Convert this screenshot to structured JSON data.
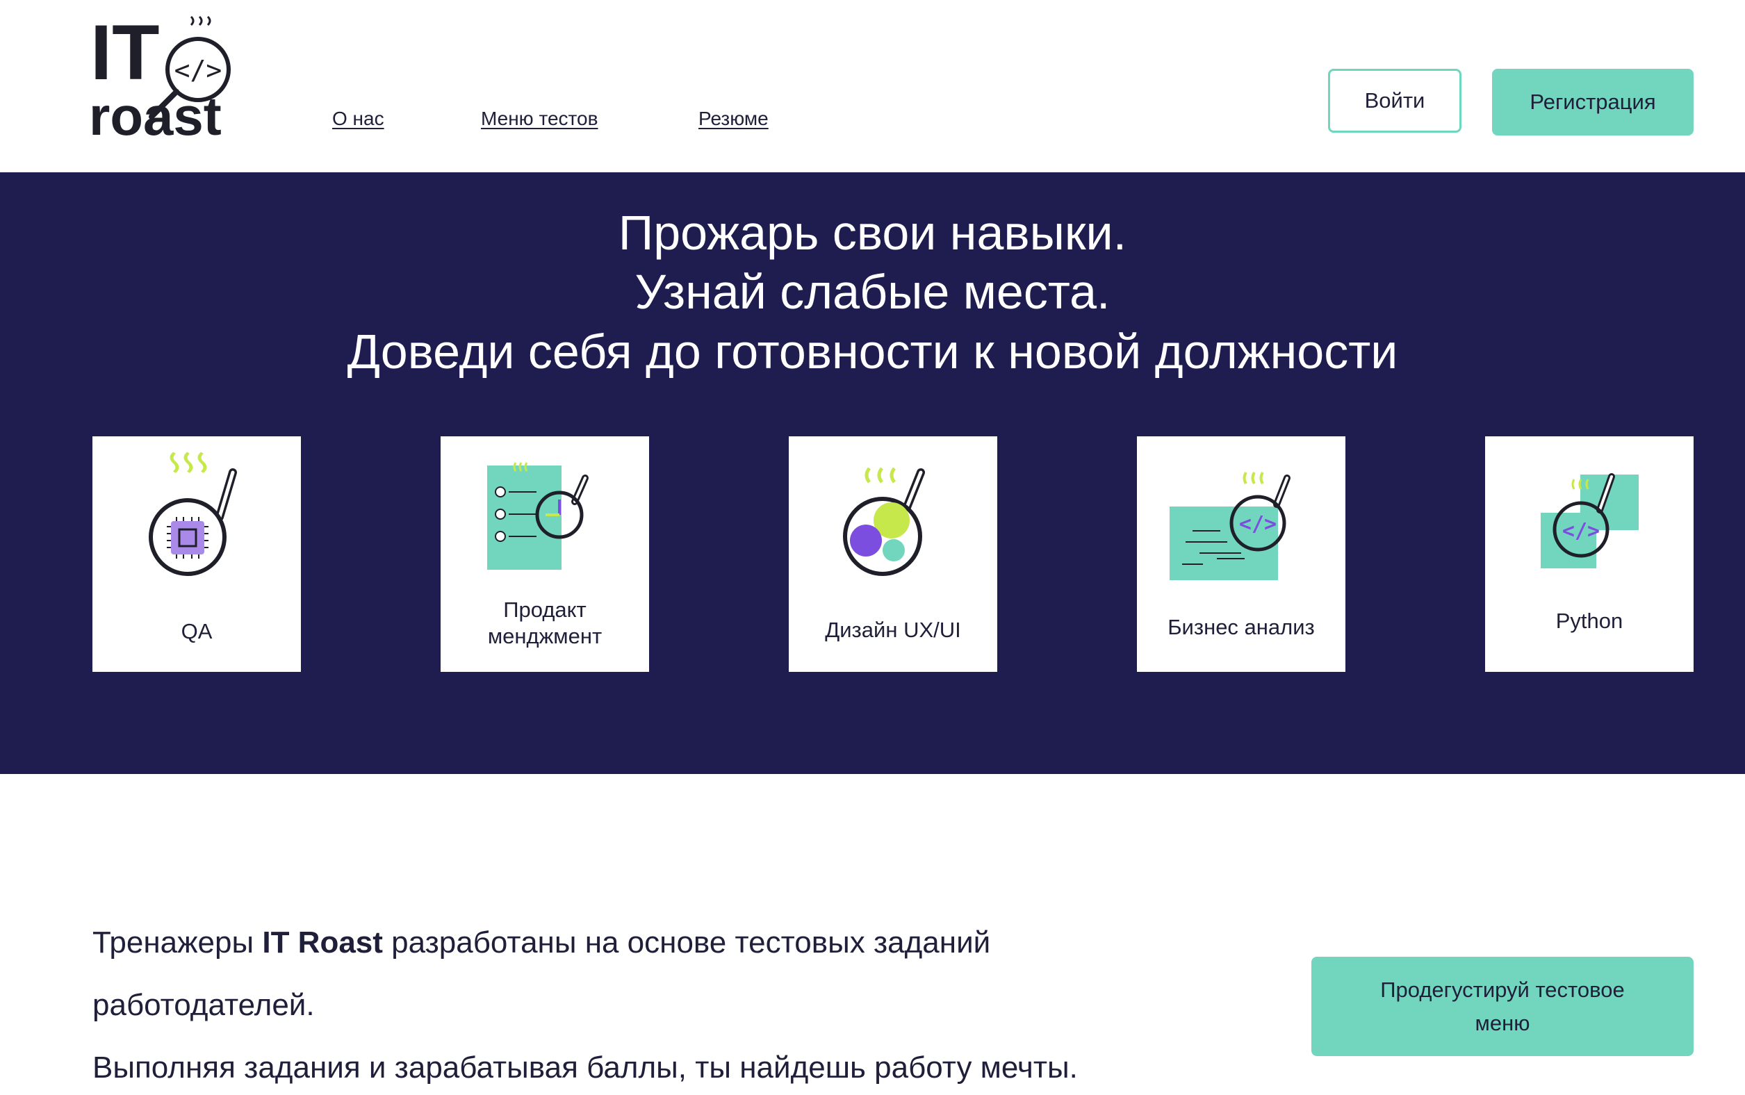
{
  "logo": {
    "line1": "IT",
    "line2": "roast",
    "icon": "frying-pan-code-icon"
  },
  "nav": {
    "about": "О нас",
    "tests_menu": "Меню тестов",
    "resume": "Резюме"
  },
  "auth": {
    "login": "Войти",
    "register": "Регистрация"
  },
  "hero": {
    "line1": "Прожарь свои навыки.",
    "line2": "Узнай слабые места.",
    "line3": "Доведи себя до готовности к новой должности"
  },
  "categories": [
    {
      "label": "QA",
      "icon": "chip-pan-icon"
    },
    {
      "label_line1": "Продакт",
      "label_line2": "менджмент",
      "icon": "checklist-pan-icon"
    },
    {
      "label": "Дизайн UX/UI",
      "icon": "design-pan-icon"
    },
    {
      "label": "Бизнес анализ",
      "icon": "analysis-pan-icon"
    },
    {
      "label": "Python",
      "icon": "python-pan-icon"
    }
  ],
  "intro": {
    "p1_pre": "Тренажеры ",
    "p1_brand": "IT Roast",
    "p1_post": " разработаны на основе тестовых заданий",
    "p1_line2": "работодателей.",
    "p2": "Выполняя задания и зарабатывая баллы, ты найдешь работу мечты."
  },
  "cta": {
    "tasting": "Продегустируй тестовое меню"
  },
  "colors": {
    "navy": "#1f1d4f",
    "mint": "#72d6be",
    "lime": "#c6e84a",
    "purple": "#7b4ee0",
    "lavender": "#a98ae8"
  }
}
